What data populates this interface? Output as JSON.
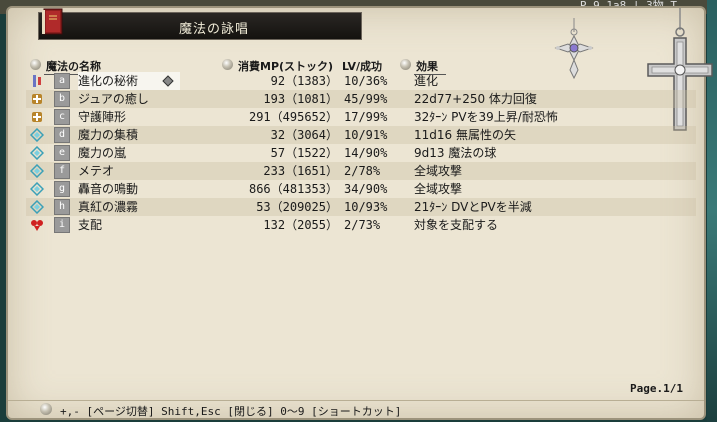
{
  "bg_strip_text": "P,9 1a8 | 3物 T",
  "window": {
    "title": "魔法の詠唱"
  },
  "headers": {
    "name": "魔法の名称",
    "cost": "消費MP(ストック)",
    "lv": "LV/成功",
    "effect": "効果"
  },
  "spells": [
    {
      "key": "a",
      "name": "進化の秘術",
      "cost": "92（1383）",
      "lv": "10/36%",
      "effect": "進化",
      "icon": "evolution-icon",
      "selected": true
    },
    {
      "key": "b",
      "name": "ジュアの癒し",
      "cost": "193（1081）",
      "lv": "45/99%",
      "effect": "22d77+250 体力回復",
      "icon": "heal-icon",
      "selected": false
    },
    {
      "key": "c",
      "name": "守護陣形",
      "cost": "291（495652）",
      "lv": "17/99%",
      "effect": "32ﾀｰﾝ PVを39上昇/耐恐怖",
      "icon": "protect-icon",
      "selected": false
    },
    {
      "key": "d",
      "name": "魔力の集積",
      "cost": "32（3064）",
      "lv": "10/91%",
      "effect": "11d16 無属性の矢",
      "icon": "magic-icon",
      "selected": false
    },
    {
      "key": "e",
      "name": "魔力の嵐",
      "cost": "57（1522）",
      "lv": "14/90%",
      "effect": "9d13 魔法の球",
      "icon": "magic-icon",
      "selected": false
    },
    {
      "key": "f",
      "name": "メテオ",
      "cost": "233（1651）",
      "lv": "2/78%",
      "effect": "全域攻撃",
      "icon": "magic-icon",
      "selected": false
    },
    {
      "key": "g",
      "name": "轟音の鳴動",
      "cost": "866（481353）",
      "lv": "34/90%",
      "effect": "全域攻撃",
      "icon": "magic-icon",
      "selected": false
    },
    {
      "key": "h",
      "name": "真紅の濃霧",
      "cost": "53（209025）",
      "lv": "10/93%",
      "effect": "21ﾀｰﾝ DVとPVを半減",
      "icon": "magic-icon",
      "selected": false
    },
    {
      "key": "i",
      "name": "支配",
      "cost": "132（2055）",
      "lv": "2/73%",
      "effect": "対象を支配する",
      "icon": "domination-icon",
      "selected": false
    }
  ],
  "page": "Page.1/1",
  "footer": "+,- [ページ切替] Shift,Esc [閉じる] 0〜9 [ショートカット]",
  "colors": {
    "panel_bg": "#ece5d3",
    "title_bar": "#1a1714",
    "key_badge": "#9a9a9a",
    "magic_icon": "#3aa0b8",
    "heal_icon": "#b8842a",
    "domination_icon": "#d02020"
  }
}
